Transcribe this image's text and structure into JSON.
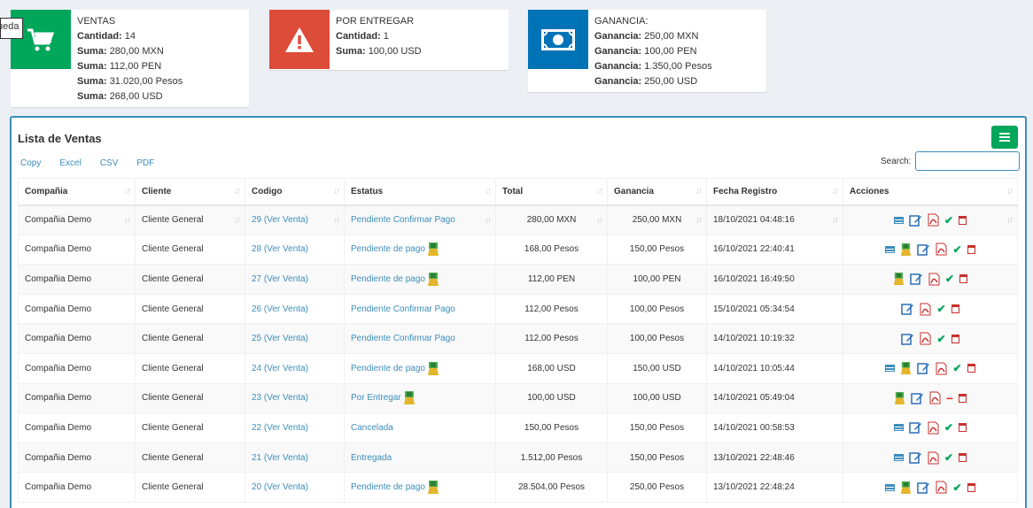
{
  "tooltip": "ueda",
  "boxes": {
    "ventas": {
      "title": "VENTAS",
      "lines": [
        {
          "label": "Cantidad:",
          "value": "14"
        },
        {
          "label": "Suma:",
          "value": "280,00 MXN"
        },
        {
          "label": "Suma:",
          "value": "112,00 PEN"
        },
        {
          "label": "Suma:",
          "value": "31.020,00 Pesos"
        },
        {
          "label": "Suma:",
          "value": "268,00 USD"
        }
      ]
    },
    "entregar": {
      "title": "POR ENTREGAR",
      "lines": [
        {
          "label": "Cantidad:",
          "value": "1"
        },
        {
          "label": "Suma:",
          "value": "100,00 USD"
        }
      ]
    },
    "ganancia": {
      "title": "GANANCIA:",
      "lines": [
        {
          "label": "Ganancia:",
          "value": "250,00 MXN"
        },
        {
          "label": "Ganancia:",
          "value": "100,00 PEN"
        },
        {
          "label": "Ganancia:",
          "value": "1.350,00 Pesos"
        },
        {
          "label": "Ganancia:",
          "value": "250,00 USD"
        }
      ]
    }
  },
  "panel": {
    "title": "Lista de Ventas",
    "exports": [
      "Copy",
      "Excel",
      "CSV",
      "PDF"
    ],
    "search_label": "Search:",
    "search_value": ""
  },
  "table": {
    "headers": [
      "Compañia",
      "Cliente",
      "Codigo",
      "Estatus",
      "Total",
      "Ganancia",
      "Fecha Registro",
      "Acciones"
    ],
    "rows": [
      {
        "company": "Compañia Demo",
        "client": "Cliente General",
        "code": "29 (Ver Venta)",
        "status": "Pendiente Confirmar Pago",
        "status_icon": false,
        "total": "280,00 MXN",
        "profit": "250,00 MXN",
        "date": "18/10/2021 04:48:16",
        "actions": [
          "list-icon",
          "edit-icon",
          "pdf-icon",
          "check-icon",
          "trash-icon"
        ]
      },
      {
        "company": "Compañia Demo",
        "client": "Cliente General",
        "code": "28 (Ver Venta)",
        "status": "Pendiente de pago",
        "status_icon": true,
        "total": "168,00 Pesos",
        "profit": "150,00 Pesos",
        "date": "16/10/2021 22:40:41",
        "actions": [
          "list-icon",
          "money-bag-icon",
          "edit-icon",
          "pdf-icon",
          "check-icon",
          "trash-icon"
        ]
      },
      {
        "company": "Compañia Demo",
        "client": "Cliente General",
        "code": "27 (Ver Venta)",
        "status": "Pendiente de pago",
        "status_icon": true,
        "total": "112,00 PEN",
        "profit": "100,00 PEN",
        "date": "16/10/2021 16:49:50",
        "actions": [
          "money-bag-icon",
          "edit-icon",
          "pdf-icon",
          "check-icon",
          "trash-icon"
        ]
      },
      {
        "company": "Compañia Demo",
        "client": "Cliente General",
        "code": "26 (Ver Venta)",
        "status": "Pendiente Confirmar Pago",
        "status_icon": false,
        "total": "112,00 Pesos",
        "profit": "100,00 Pesos",
        "date": "15/10/2021 05:34:54",
        "actions": [
          "edit-icon",
          "pdf-icon",
          "check-icon",
          "trash-icon"
        ]
      },
      {
        "company": "Compañia Demo",
        "client": "Cliente General",
        "code": "25 (Ver Venta)",
        "status": "Pendiente Confirmar Pago",
        "status_icon": false,
        "total": "112,00 Pesos",
        "profit": "100,00 Pesos",
        "date": "14/10/2021 10:19:32",
        "actions": [
          "edit-icon",
          "pdf-icon",
          "check-icon",
          "trash-icon"
        ]
      },
      {
        "company": "Compañia Demo",
        "client": "Cliente General",
        "code": "24 (Ver Venta)",
        "status": "Pendiente de pago",
        "status_icon": true,
        "total": "168,00 USD",
        "profit": "150,00 USD",
        "date": "14/10/2021 10:05:44",
        "actions": [
          "list-icon",
          "money-bag-icon",
          "edit-icon",
          "pdf-icon",
          "check-icon",
          "trash-icon"
        ]
      },
      {
        "company": "Compañia Demo",
        "client": "Cliente General",
        "code": "23 (Ver Venta)",
        "status": "Por Entregar",
        "status_icon": true,
        "total": "100,00 USD",
        "profit": "100,00 USD",
        "date": "14/10/2021 05:49:04",
        "actions": [
          "money-bag-icon",
          "edit-icon",
          "pdf-icon",
          "minus-icon",
          "trash-icon"
        ]
      },
      {
        "company": "Compañia Demo",
        "client": "Cliente General",
        "code": "22 (Ver Venta)",
        "status": "Cancelada",
        "status_icon": false,
        "total": "150,00 Pesos",
        "profit": "150,00 Pesos",
        "date": "14/10/2021 00:58:53",
        "actions": [
          "list-icon",
          "edit-icon",
          "pdf-icon",
          "check-icon",
          "trash-icon"
        ]
      },
      {
        "company": "Compañia Demo",
        "client": "Cliente General",
        "code": "21 (Ver Venta)",
        "status": "Entregada",
        "status_icon": false,
        "total": "1.512,00 Pesos",
        "profit": "150,00 Pesos",
        "date": "13/10/2021 22:48:46",
        "actions": [
          "list-icon",
          "edit-icon",
          "pdf-icon",
          "check-icon",
          "trash-icon"
        ]
      },
      {
        "company": "Compañia Demo",
        "client": "Cliente General",
        "code": "20 (Ver Venta)",
        "status": "Pendiente de pago",
        "status_icon": true,
        "total": "28.504,00 Pesos",
        "profit": "250,00 Pesos",
        "date": "13/10/2021 22:48:24",
        "actions": [
          "list-icon",
          "money-bag-icon",
          "edit-icon",
          "pdf-icon",
          "check-icon",
          "trash-icon"
        ]
      }
    ]
  },
  "colors": {
    "green": "#00a65a",
    "red": "#dd4b39",
    "blue": "#0073b7",
    "link": "#3c8dbc"
  }
}
